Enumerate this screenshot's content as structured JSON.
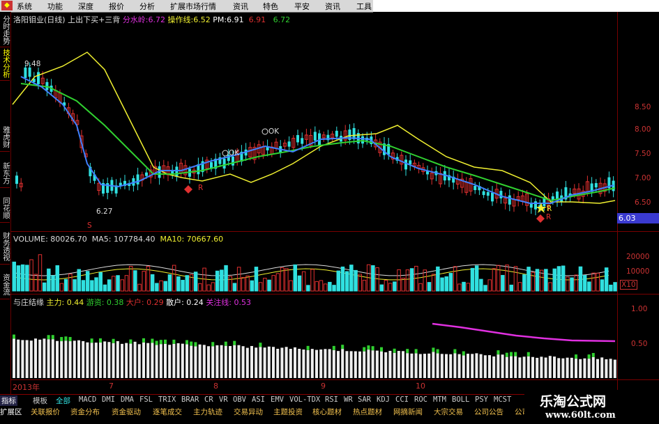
{
  "menu": {
    "items": [
      "系统",
      "功能",
      "深度",
      "报价",
      "分析",
      "扩展市场行情",
      "资讯",
      "特色",
      "平安",
      "资讯",
      "工具"
    ]
  },
  "left_tabs": [
    "分时走势",
    "技术分析",
    "雅虎财",
    "新东方",
    "同花顺",
    "财务透视",
    "资金流"
  ],
  "main_chart": {
    "stock": "洛阳钼业(日线)",
    "formula": "上出下买+三背",
    "fenshui_label": "分水岭:",
    "fenshui_value": "6.72",
    "caozuo_label": "操作线:",
    "caozuo_value": "6.52",
    "pm_label": "PM:",
    "pm_value": "6.91",
    "val_red": "6.91",
    "val_green": "6.72",
    "high_label": "9.48",
    "low_label": "6.27",
    "current_price": "6.03",
    "y_ticks": [
      "8.50",
      "8.00",
      "7.50",
      "7.00",
      "6.50"
    ],
    "ok_labels": [
      "OK",
      "OK"
    ],
    "r_labels": [
      "R",
      "R",
      "R"
    ],
    "s_label": "S"
  },
  "volume_panel": {
    "title": "VOLUME: 80026.70",
    "ma5": "MA5: 107784.40",
    "ma10": "MA10: 70667.60",
    "y_ticks": [
      "20000",
      "10000"
    ],
    "unit": "X10"
  },
  "capital_panel": {
    "title": "与庄结缘",
    "zhuli": "主力: 0.44",
    "youzi": "游资: 0.38",
    "dahu": "大户: 0.29",
    "sanhu": "散户: 0.24",
    "guanzhu": "关注线: 0.53",
    "y_ticks": [
      "1.00",
      "0.50"
    ]
  },
  "date_axis": [
    "2013年",
    "7",
    "8",
    "9",
    "10"
  ],
  "indicator_tabs": [
    "指标",
    "模板",
    "全部",
    "MACD",
    "DMI",
    "DMA",
    "FSL",
    "TRIX",
    "BRAR",
    "CR",
    "VR",
    "OBV",
    "ASI",
    "EMV",
    "VOL-TDX",
    "RSI",
    "WR",
    "SAR",
    "KDJ",
    "CCI",
    "ROC",
    "MTM",
    "BOLL",
    "PSY",
    "MCST"
  ],
  "feature_tabs": [
    "扩展区",
    "关联报价",
    "资金分布",
    "资金驱动",
    "逐笔成交",
    "主力轨迹",
    "交易异动",
    "主题投资",
    "核心题材",
    "热点题材",
    "网摘新闻",
    "大宗交易",
    "公司公告",
    "公司"
  ],
  "watermark": {
    "cn": "乐淘公式网",
    "url": "www.60lt.com"
  },
  "colors": {
    "up": "#e03030",
    "down": "#30e0e0",
    "yellow_line": "#f0f030",
    "green_line": "#30d030",
    "blue_line": "#4080ff",
    "magenta": "#e030e0"
  }
}
